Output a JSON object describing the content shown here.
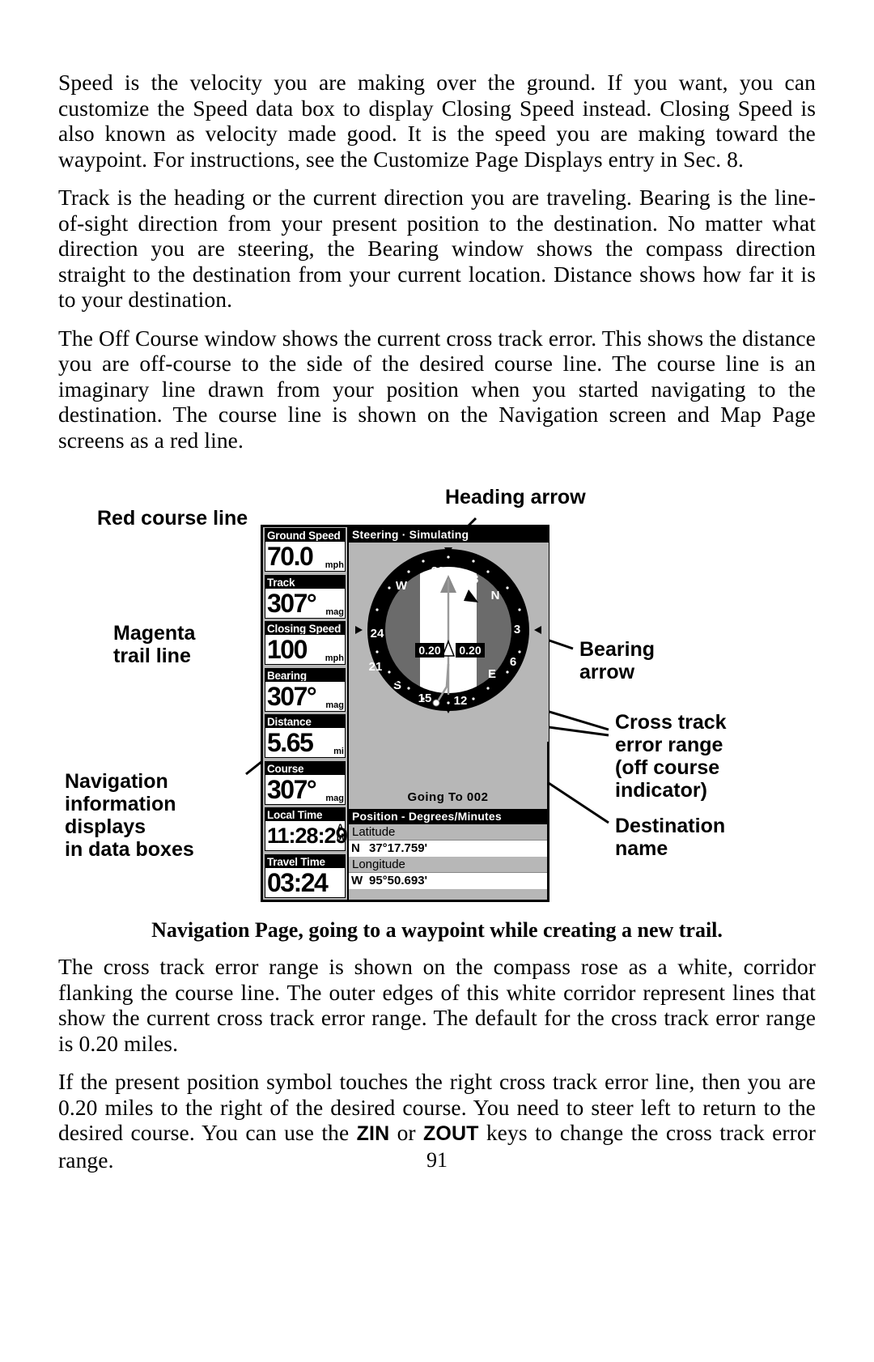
{
  "page": {
    "folio": "91",
    "paragraphs": [
      "Speed is the velocity you are making over the ground. If you want, you can customize the Speed data box to display Closing Speed instead. Closing Speed is also known as velocity made good. It is the speed you are making toward the waypoint. For instructions, see the Customize Page Displays entry in Sec. 8.",
      "Track is the heading or the current direction you are traveling. Bearing is the line-of-sight direction from your present position to the destination. No matter what direction you are steering, the Bearing window shows the compass direction straight to the destination from your current location. Distance shows how far it is to your destination.",
      "The Off Course window shows the current cross track error. This shows the distance you are off-course to the side of the desired course line. The course line is an imaginary line drawn from your position when you started navigating to the destination. The course line is shown on the Navigation screen and Map Page screens as a red line."
    ],
    "caption": "Navigation Page, going to a waypoint while creating a new trail.",
    "paragraphs_after": [
      "The cross track error range is shown on the compass rose as a white, corridor flanking the course line. The outer edges of this white corridor represent lines that show the current cross track error range. The default for the cross track error range is 0.20 miles."
    ],
    "final_paragraph": {
      "part1": "If the present position symbol touches the right cross track error line, then you are 0.20 miles to the right of the desired course. You need to steer left to return to the desired course. You can use the ",
      "key1": "ZIN",
      "mid": " or ",
      "key2": "ZOUT",
      "part2": " keys to change the cross track error range."
    }
  },
  "figure": {
    "annotations": {
      "heading_arrow": "Heading arrow",
      "red_course_line": "Red course line",
      "magenta_trail_line": "Magenta\ntrail line",
      "navigation_info": "Navigation\ninformation\ndisplays\nin data boxes",
      "bearing_arrow": "Bearing\narrow",
      "cross_track": "Cross track\nerror range\n(off course\nindicator)",
      "destination_name": "Destination\nname"
    }
  },
  "gps": {
    "steering_title": "Steering · Simulating",
    "databoxes": [
      {
        "title": "Ground Speed",
        "value": "70.0",
        "unit": "mph"
      },
      {
        "title": "Track",
        "value": "307°",
        "unit": "mag"
      },
      {
        "title": "Closing Speed",
        "value": "100",
        "unit": "mph"
      },
      {
        "title": "Bearing",
        "value": "307°",
        "unit": "mag"
      },
      {
        "title": "Distance",
        "value": "5.65",
        "unit": "mi"
      },
      {
        "title": "Course",
        "value": "307°",
        "unit": "mag"
      },
      {
        "title": "Local Time",
        "value": "11:28:29",
        "unit": "AM"
      },
      {
        "title": "Travel Time",
        "value": "03:24",
        "unit": ""
      }
    ],
    "compass": {
      "cardinals": [
        "N",
        "E",
        "S",
        "W"
      ],
      "numbers": [
        "30",
        "33",
        "24",
        "21",
        "15",
        "12",
        "3",
        "6"
      ],
      "xte_left_label": "0.20",
      "xte_right_label": "0.20"
    },
    "going_to": "Going To 002",
    "position": {
      "title": "Position - Degrees/Minutes",
      "latitude_label": "Latitude",
      "latitude_hemi": "N",
      "latitude_value": "37°17.759'",
      "longitude_label": "Longitude",
      "longitude_hemi": "W",
      "longitude_value": "95°50.693'"
    }
  }
}
